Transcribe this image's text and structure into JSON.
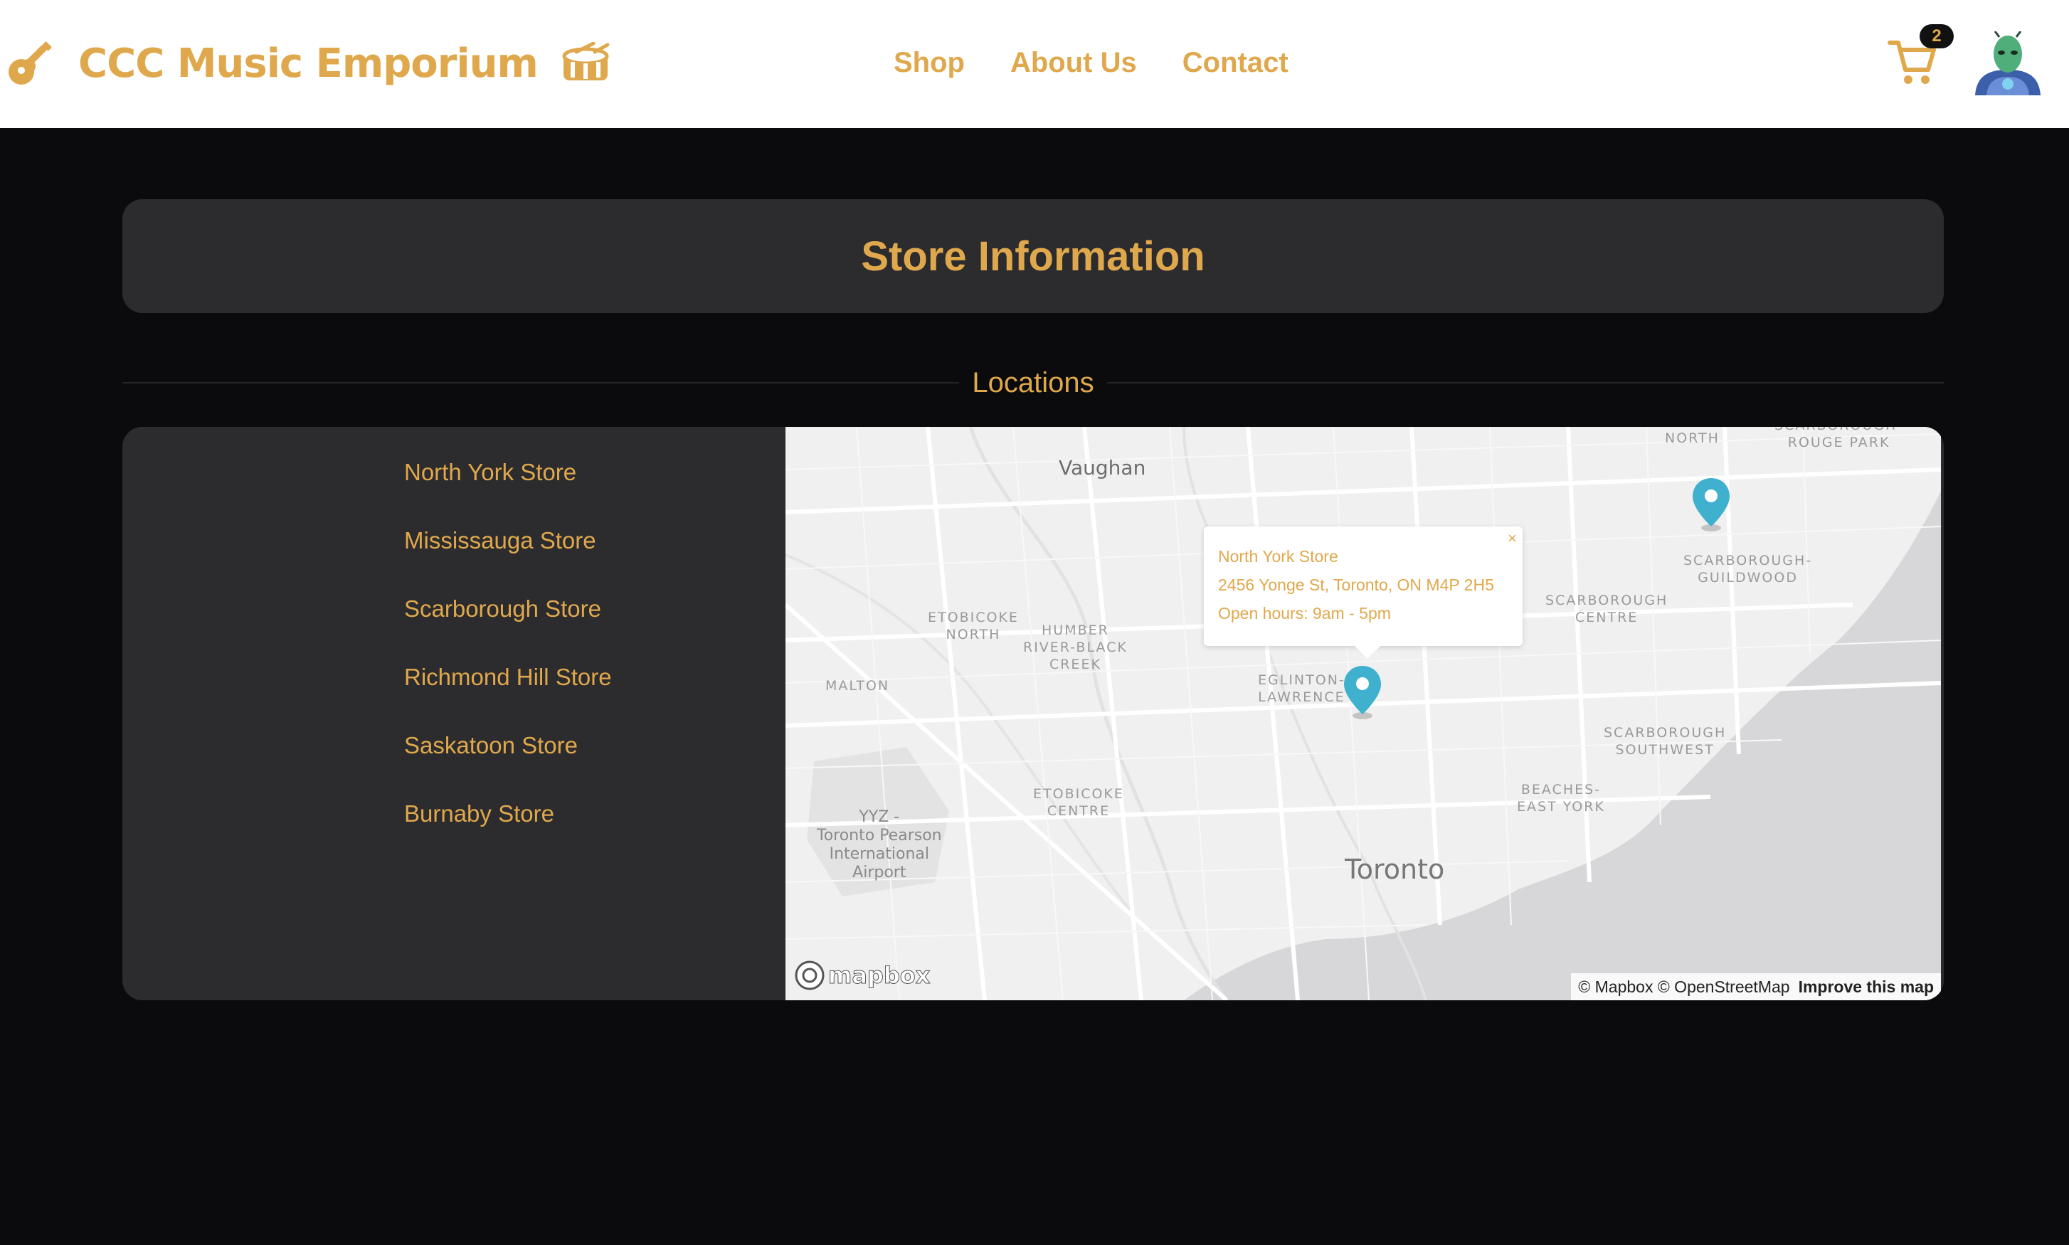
{
  "header": {
    "brand_title": "CCC Music Emporium",
    "nav": [
      "Shop",
      "About Us",
      "Contact"
    ],
    "cart_count": "2"
  },
  "page": {
    "title": "Store Information",
    "section_heading": "Locations"
  },
  "stores": [
    "North York Store",
    "Mississauga Store",
    "Scarborough Store",
    "Richmond Hill Store",
    "Saskatoon Store",
    "Burnaby Store"
  ],
  "map": {
    "labels": {
      "vaughan": "Vaughan",
      "north": "NORTH",
      "rouge_park": "SCARBOROUGH-\nROUGE PARK",
      "guildwood": "SCARBOROUGH-\nGUILDWOOD",
      "scarborough_centre": "SCARBOROUGH\nCENTRE",
      "etobicoke_north": "ETOBICOKE\nNORTH",
      "humber": "HUMBER\nRIVER-BLACK\nCREEK",
      "malton": "MALTON",
      "eglinton": "EGLINTON-\nLAWRENCE",
      "scarborough_southwest": "SCARBOROUGH\nSOUTHWEST",
      "etobicoke_centre": "ETOBICOKE\nCENTRE",
      "beaches": "BEACHES-\nEAST YORK",
      "airport": "YYZ -\nToronto Pearson\nInternational\nAirport",
      "toronto": "Toronto"
    },
    "popup": {
      "name": "North York Store",
      "address": "2456 Yonge St, Toronto, ON M4P 2H5",
      "hours": "Open hours: 9am - 5pm",
      "close": "×"
    },
    "logo": "mapbox",
    "attribution": "© Mapbox © OpenStreetMap",
    "improve": "Improve this map",
    "marker_color": "#3fb1ce"
  },
  "colors": {
    "accent": "#e0a84c",
    "background": "#0b0b0d",
    "card": "#2c2c2e"
  }
}
